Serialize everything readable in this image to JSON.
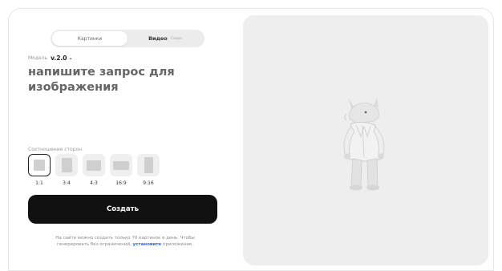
{
  "tabs": [
    {
      "label": "Картинки",
      "active": true
    },
    {
      "label": "Видео",
      "badge": "Скоро"
    }
  ],
  "model": {
    "label": "Модель",
    "value": "v.2.0"
  },
  "prompt": {
    "placeholder": "напишите запрос для изображения",
    "value": ""
  },
  "aspect": {
    "title": "Соотношение сторон",
    "options": [
      {
        "label": "1:1",
        "selected": true
      },
      {
        "label": "3:4"
      },
      {
        "label": "4:3"
      },
      {
        "label": "16:9"
      },
      {
        "label": "9:16"
      }
    ]
  },
  "create_label": "Создать",
  "note": {
    "before": "На сайте можно создать только 70 картинок в день. Чтобы генерировать без ограничений,",
    "link": "установите",
    "after": "приложение."
  },
  "preview": {
    "subject": "rhino-in-lab-coat"
  },
  "colors": {
    "button": "#111111",
    "link": "#2a6bd8",
    "preview_bg": "#eeeeee"
  }
}
